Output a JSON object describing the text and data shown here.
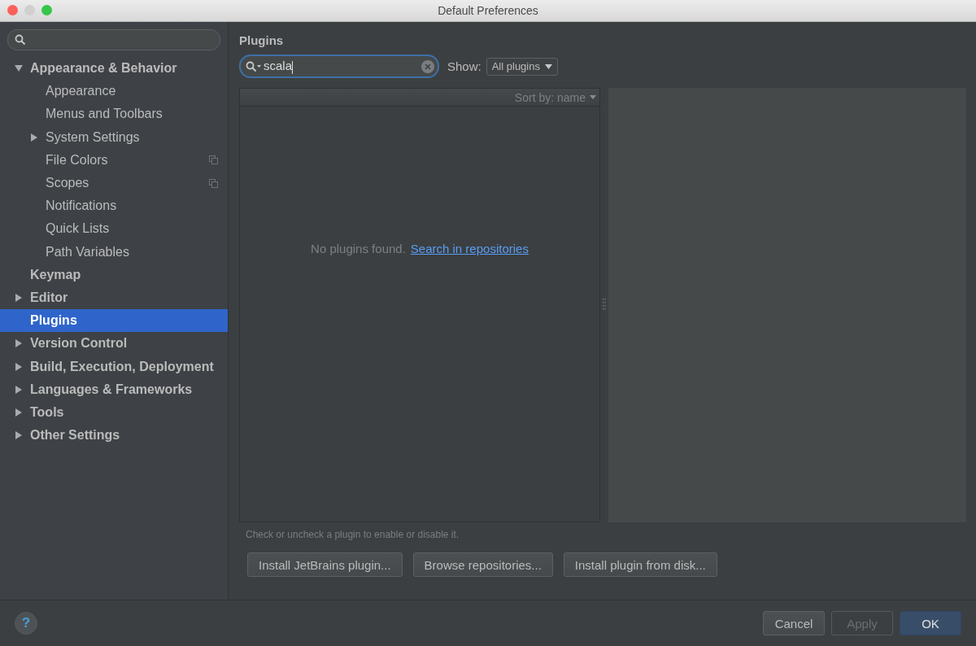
{
  "window": {
    "title": "Default Preferences"
  },
  "sidebar": {
    "items": [
      {
        "label": "Appearance & Behavior",
        "expanded": true,
        "selected": false,
        "children": [
          {
            "label": "Appearance",
            "selected": false
          },
          {
            "label": "Menus and Toolbars",
            "selected": false
          },
          {
            "label": "System Settings",
            "expanded": false,
            "selected": false
          },
          {
            "label": "File Colors",
            "selected": false,
            "project_icon": true
          },
          {
            "label": "Scopes",
            "selected": false,
            "project_icon": true
          },
          {
            "label": "Notifications",
            "selected": false
          },
          {
            "label": "Quick Lists",
            "selected": false
          },
          {
            "label": "Path Variables",
            "selected": false
          }
        ]
      },
      {
        "label": "Keymap",
        "selected": false
      },
      {
        "label": "Editor",
        "expanded": false,
        "selected": false
      },
      {
        "label": "Plugins",
        "selected": true
      },
      {
        "label": "Version Control",
        "expanded": false,
        "selected": false
      },
      {
        "label": "Build, Execution, Deployment",
        "expanded": false,
        "selected": false
      },
      {
        "label": "Languages & Frameworks",
        "expanded": false,
        "selected": false
      },
      {
        "label": "Tools",
        "expanded": false,
        "selected": false
      },
      {
        "label": "Other Settings",
        "expanded": false,
        "selected": false
      }
    ]
  },
  "content": {
    "title": "Plugins",
    "search": {
      "value": "scala"
    },
    "show_label": "Show:",
    "show_value": "All plugins",
    "sort_label": "Sort by: name",
    "empty_text": "No plugins found.",
    "empty_link": "Search in repositories",
    "hint": "Check or uncheck a plugin to enable or disable it.",
    "buttons": [
      "Install JetBrains plugin...",
      "Browse repositories...",
      "Install plugin from disk..."
    ]
  },
  "footer": {
    "help": "?",
    "buttons": [
      {
        "label": "Cancel",
        "disabled": false,
        "default": false
      },
      {
        "label": "Apply",
        "disabled": true,
        "default": false
      },
      {
        "label": "OK",
        "disabled": false,
        "default": true
      }
    ]
  }
}
